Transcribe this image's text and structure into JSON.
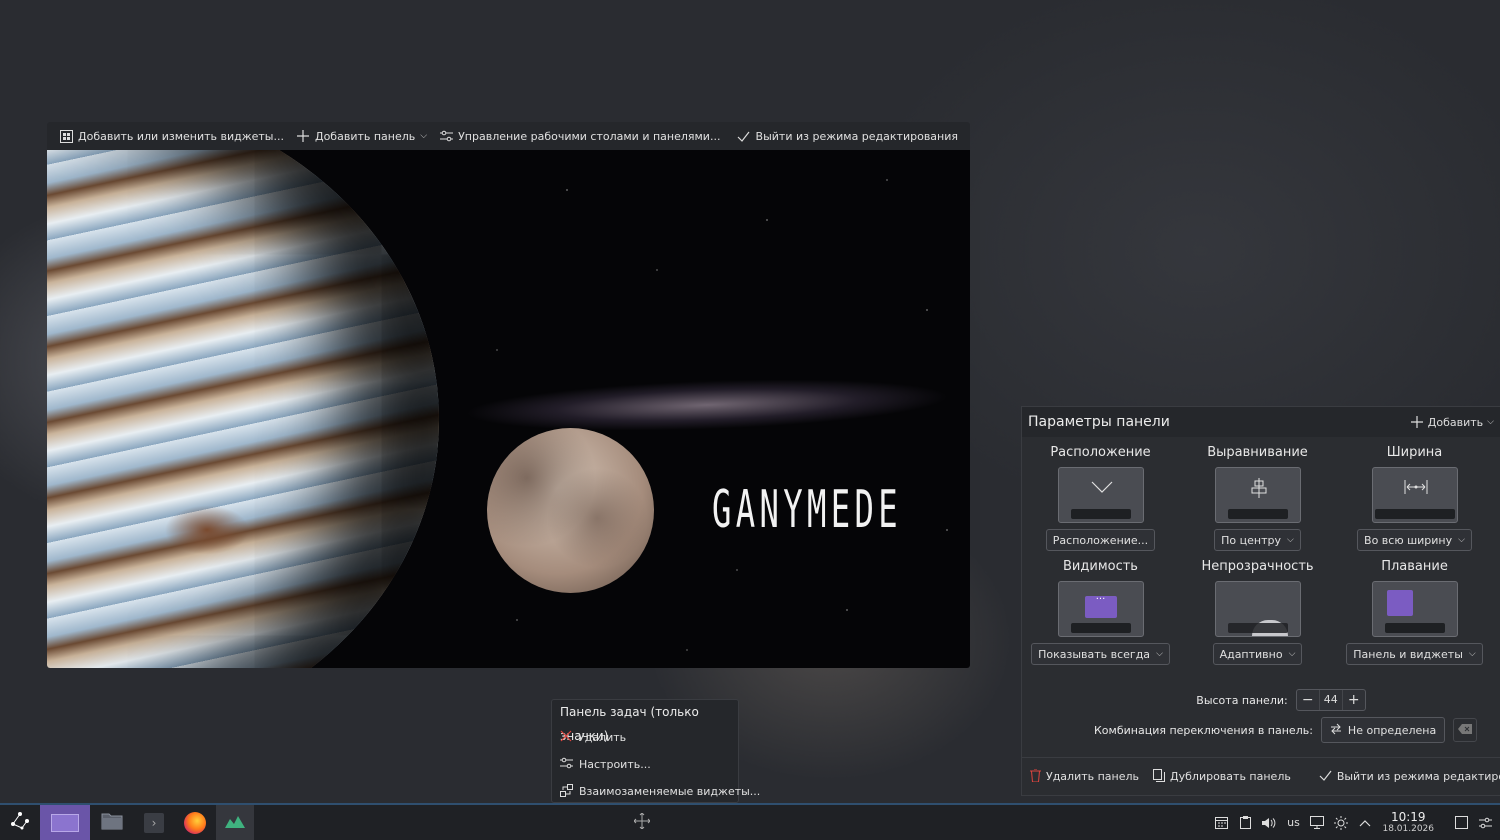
{
  "toolbar": {
    "widgets_label": "Добавить или изменить виджеты...",
    "add_panel_label": "Добавить панель",
    "manage_label": "Управление рабочими столами и панелями...",
    "exit_label": "Выйти из режима редактирования"
  },
  "wallpaper": {
    "title": "GANYMEDE"
  },
  "panel_settings": {
    "title": "Параметры панели",
    "add_label": "Добавить",
    "options": [
      {
        "label": "Расположение",
        "value": "Расположение...",
        "icon": "chevron-down-icon"
      },
      {
        "label": "Выравнивание",
        "value": "По центру",
        "icon": "center-align-icon"
      },
      {
        "label": "Ширина",
        "value": "Во всю ширину",
        "icon": "width-arrows-icon"
      },
      {
        "label": "Видимость",
        "value": "Показывать всегда",
        "icon": "visibility-icon"
      },
      {
        "label": "Непрозрачность",
        "value": "Адаптивно",
        "icon": "opacity-icon"
      },
      {
        "label": "Плавание",
        "value": "Панель и виджеты",
        "icon": "floating-icon"
      }
    ],
    "height_label": "Высота панели:",
    "height_value": "44",
    "shortcut_label": "Комбинация переключения в панель:",
    "shortcut_value": "Не определена",
    "delete_label": "Удалить панель",
    "duplicate_label": "Дублировать панель",
    "exit_label": "Выйти из режима редактирования"
  },
  "context_menu": {
    "title": "Панель задач (только значки)",
    "items": [
      {
        "label": "Удалить",
        "icon": "close-icon"
      },
      {
        "label": "Настроить...",
        "icon": "configure-icon"
      },
      {
        "label": "Взаимозаменяемые виджеты...",
        "icon": "alternatives-icon"
      }
    ]
  },
  "tray": {
    "keyboard_layout": "us",
    "time": "10:19",
    "date": "18.01.2026"
  },
  "colors": {
    "accent": "#7b5cc2",
    "danger": "#e0453e"
  }
}
